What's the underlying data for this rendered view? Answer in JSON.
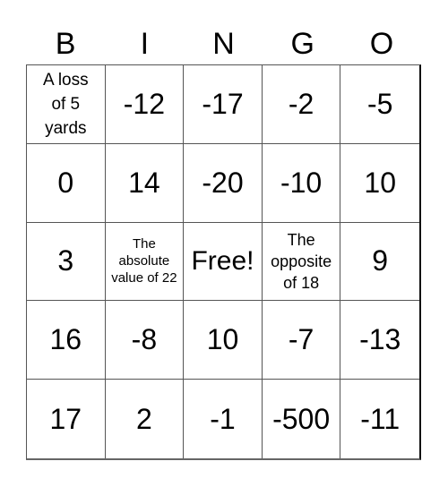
{
  "header": [
    "B",
    "I",
    "N",
    "G",
    "O"
  ],
  "cells": [
    {
      "text": "A loss of 5 yards",
      "style": "txt-md"
    },
    {
      "text": "-12",
      "style": "num"
    },
    {
      "text": "-17",
      "style": "num"
    },
    {
      "text": "-2",
      "style": "num"
    },
    {
      "text": "-5",
      "style": "num"
    },
    {
      "text": "0",
      "style": "num"
    },
    {
      "text": "14",
      "style": "num"
    },
    {
      "text": "-20",
      "style": "num"
    },
    {
      "text": "-10",
      "style": "num"
    },
    {
      "text": "10",
      "style": "num"
    },
    {
      "text": "3",
      "style": "num"
    },
    {
      "text": "The absolute value of 22",
      "style": "txt-sm"
    },
    {
      "text": "Free!",
      "style": "free"
    },
    {
      "text": "The opposite of 18",
      "style": "txt-op"
    },
    {
      "text": "9",
      "style": "num"
    },
    {
      "text": "16",
      "style": "num"
    },
    {
      "text": "-8",
      "style": "num"
    },
    {
      "text": "10",
      "style": "num"
    },
    {
      "text": "-7",
      "style": "num"
    },
    {
      "text": "-13",
      "style": "num"
    },
    {
      "text": "17",
      "style": "num"
    },
    {
      "text": "2",
      "style": "num"
    },
    {
      "text": "-1",
      "style": "num"
    },
    {
      "text": "-500",
      "style": "num"
    },
    {
      "text": "-11",
      "style": "num"
    }
  ]
}
